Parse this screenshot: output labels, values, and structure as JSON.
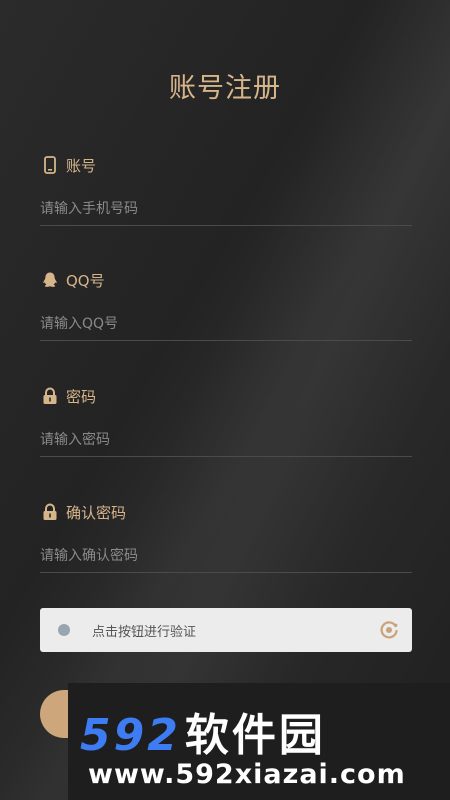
{
  "page": {
    "title": "账号注册"
  },
  "fields": [
    {
      "label": "账号",
      "placeholder": "请输入手机号码",
      "icon": "phone-icon"
    },
    {
      "label": "QQ号",
      "placeholder": "请输入QQ号",
      "icon": "qq-icon"
    },
    {
      "label": "密码",
      "placeholder": "请输入密码",
      "icon": "lock-icon"
    },
    {
      "label": "确认密码",
      "placeholder": "请输入确认密码",
      "icon": "lock-icon"
    }
  ],
  "verification": {
    "text": "点击按钮进行验证"
  },
  "watermark": {
    "number": "592",
    "brand": "软件园",
    "url": "www.592xiazai.com"
  },
  "colors": {
    "accent": "#d7b58a",
    "button": "#cda67b",
    "watermark_blue": "#3d7cf2"
  }
}
